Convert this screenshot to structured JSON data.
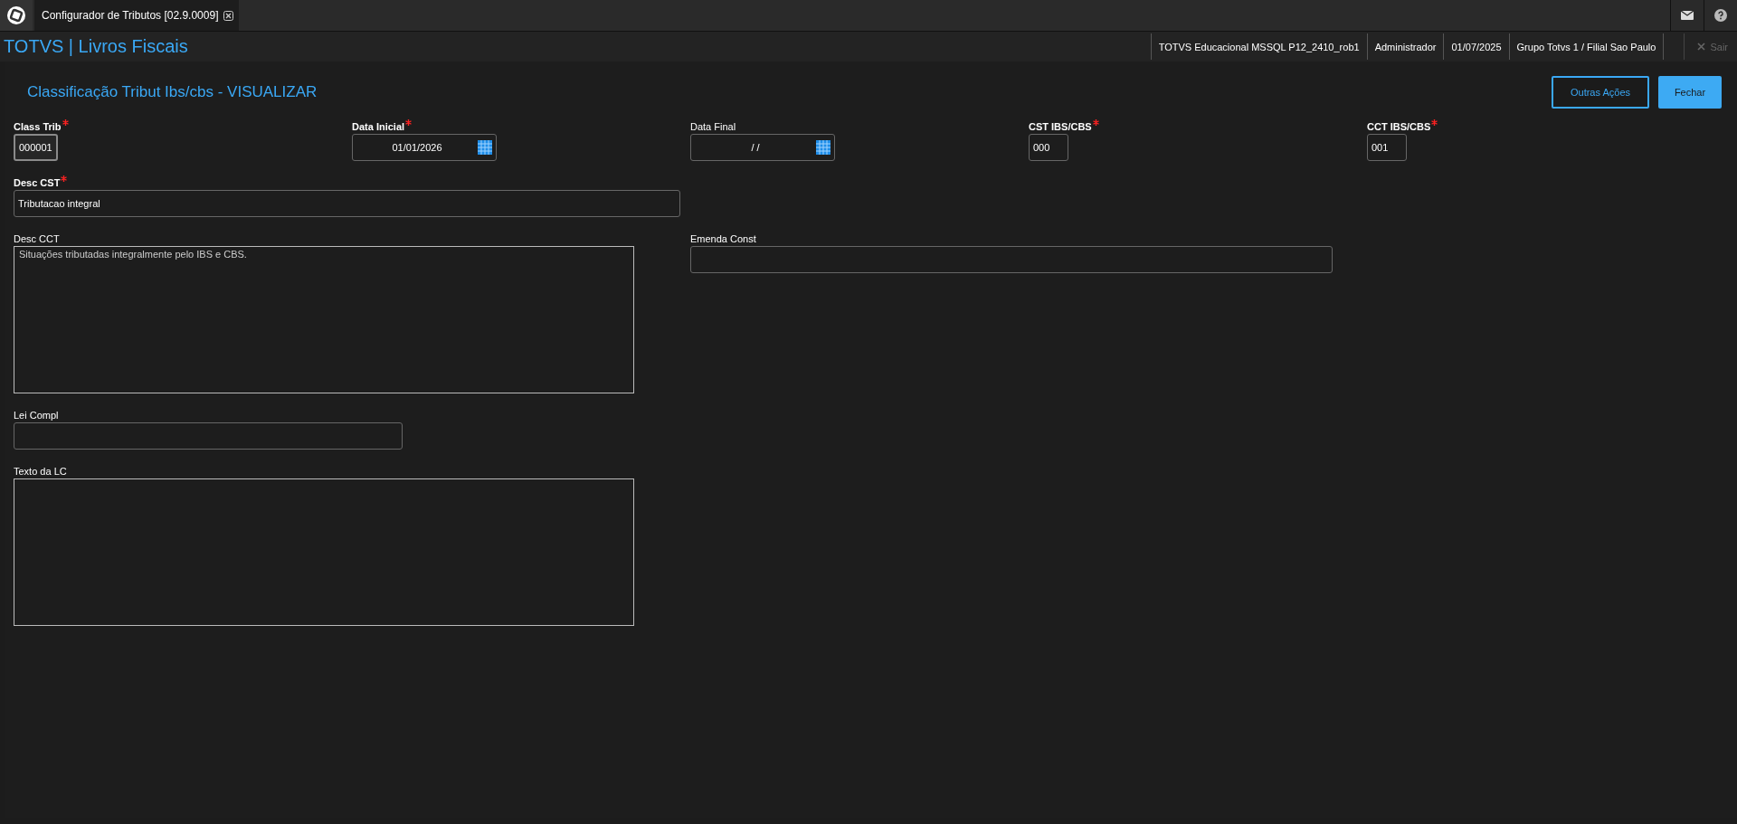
{
  "tabs": [
    {
      "label": "Configurador de Tributos [02.9.0009]",
      "selected": true
    }
  ],
  "app_title": "TOTVS | Livros Fiscais",
  "session_info": [
    "TOTVS Educacional MSSQL P12_2410_rob1",
    "Administrador",
    "01/07/2025",
    "Grupo Totvs 1 / Filial Sao Paulo"
  ],
  "exit": {
    "label": "Sair",
    "disabled": true
  },
  "form": {
    "title": "Classificação Tribut Ibs/cbs - VISUALIZAR",
    "actions": [
      {
        "label": "Outras Ações",
        "kind": "outline"
      },
      {
        "label": "Fechar",
        "kind": "primary"
      }
    ],
    "fields": [
      {
        "label": "Class Trib",
        "required": true,
        "kind": "text",
        "value": "000001",
        "focused": true
      },
      {
        "label": "Data Inicial",
        "required": true,
        "kind": "date",
        "value": "01/01/2026"
      },
      {
        "label": "Data Final",
        "required": false,
        "kind": "date",
        "value": "/ /"
      },
      {
        "label": "CST IBS/CBS",
        "required": true,
        "kind": "text",
        "value": "000",
        "focused": false
      },
      {
        "label": "CCT IBS/CBS",
        "required": true,
        "kind": "text",
        "value": "001",
        "focused": false
      },
      {
        "label": "Desc CST",
        "required": true,
        "kind": "text",
        "value": "Tributacao integral",
        "focused": false
      },
      {
        "label": "Desc CCT",
        "required": false,
        "kind": "textarea",
        "value": "Situações tributadas integralmente pelo IBS e CBS."
      },
      {
        "label": "Emenda Const",
        "required": false,
        "kind": "text",
        "focused": false
      },
      {
        "label": "Lei Compl",
        "required": false,
        "kind": "text",
        "focused": false
      },
      {
        "label": "Texto da LC",
        "required": false,
        "kind": "textarea"
      }
    ]
  }
}
